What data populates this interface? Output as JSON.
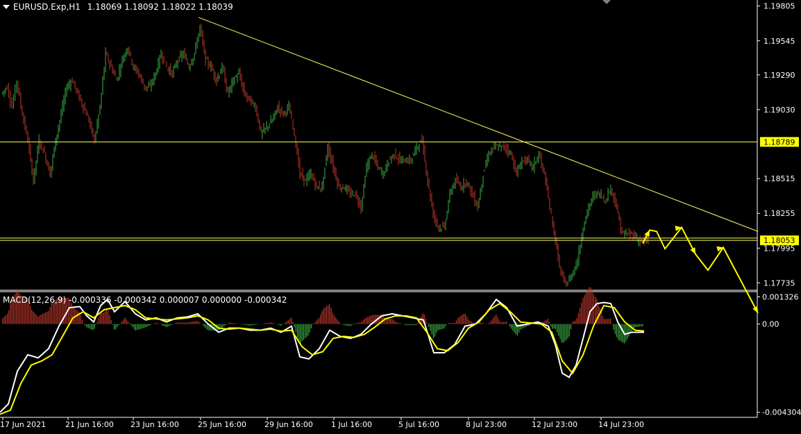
{
  "header": {
    "symbol": "EURUSD.Exp,H1",
    "ohlc": "1.18069 1.18092 1.18022 1.18039"
  },
  "indicator": {
    "label": "MACD(12,26,9) -0.000336 -0.000342 0.000007 0.000000 -0.000342"
  },
  "colors": {
    "background": "#000000",
    "bull": "#3cb043",
    "bear": "#c0392b",
    "level_line": "#ffff66",
    "level_tag": "#ffff00",
    "arrow": "#ffff00",
    "macd_main": "#ffffff",
    "macd_signal": "#ffff00",
    "grid": "#ffffff"
  },
  "chart_data": [
    {
      "type": "candlestick",
      "price_axis_ticks": [
        "1.19805",
        "1.19545",
        "1.19290",
        "1.19030",
        "1.18515",
        "1.18255",
        "1.17995",
        "1.17735"
      ],
      "ylim": [
        1.1768,
        1.1985
      ],
      "time_axis_ticks": [
        "17 Jun 2021",
        "21 Jun 16:00",
        "23 Jun 16:00",
        "25 Jun 16:00",
        "29 Jun 16:00",
        "1 Jul 16:00",
        "5 Jul 16:00",
        "8 Jul 23:00",
        "12 Jul 23:00",
        "14 Jul 23:00"
      ],
      "close_path": [
        [
          0,
          1.1915
        ],
        [
          8,
          1.192
        ],
        [
          15,
          1.1905
        ],
        [
          22,
          1.1925
        ],
        [
          30,
          1.19
        ],
        [
          38,
          1.188
        ],
        [
          46,
          1.185
        ],
        [
          54,
          1.188
        ],
        [
          62,
          1.187
        ],
        [
          70,
          1.1855
        ],
        [
          78,
          1.188
        ],
        [
          86,
          1.19
        ],
        [
          94,
          1.192
        ],
        [
          102,
          1.1925
        ],
        [
          110,
          1.1915
        ],
        [
          118,
          1.1905
        ],
        [
          126,
          1.1895
        ],
        [
          134,
          1.188
        ],
        [
          142,
          1.1905
        ],
        [
          150,
          1.1945
        ],
        [
          158,
          1.1935
        ],
        [
          166,
          1.1925
        ],
        [
          174,
          1.194
        ],
        [
          182,
          1.195
        ],
        [
          190,
          1.1935
        ],
        [
          198,
          1.193
        ],
        [
          206,
          1.192
        ],
        [
          214,
          1.192
        ],
        [
          222,
          1.193
        ],
        [
          230,
          1.1945
        ],
        [
          238,
          1.1935
        ],
        [
          246,
          1.193
        ],
        [
          254,
          1.194
        ],
        [
          262,
          1.1945
        ],
        [
          270,
          1.1935
        ],
        [
          278,
          1.1945
        ],
        [
          286,
          1.1965
        ],
        [
          294,
          1.194
        ],
        [
          302,
          1.1935
        ],
        [
          310,
          1.1925
        ],
        [
          318,
          1.1935
        ],
        [
          326,
          1.1915
        ],
        [
          334,
          1.1925
        ],
        [
          342,
          1.193
        ],
        [
          350,
          1.1915
        ],
        [
          358,
          1.191
        ],
        [
          366,
          1.1905
        ],
        [
          374,
          1.1885
        ],
        [
          382,
          1.189
        ],
        [
          390,
          1.1895
        ],
        [
          398,
          1.1905
        ],
        [
          406,
          1.19
        ],
        [
          414,
          1.1905
        ],
        [
          422,
          1.1885
        ],
        [
          430,
          1.1855
        ],
        [
          438,
          1.185
        ],
        [
          446,
          1.1855
        ],
        [
          454,
          1.1845
        ],
        [
          462,
          1.1845
        ],
        [
          470,
          1.1875
        ],
        [
          478,
          1.186
        ],
        [
          486,
          1.1845
        ],
        [
          494,
          1.1845
        ],
        [
          502,
          1.184
        ],
        [
          510,
          1.184
        ],
        [
          518,
          1.183
        ],
        [
          526,
          1.186
        ],
        [
          534,
          1.187
        ],
        [
          542,
          1.186
        ],
        [
          550,
          1.1855
        ],
        [
          558,
          1.1865
        ],
        [
          566,
          1.187
        ],
        [
          574,
          1.1865
        ],
        [
          582,
          1.1865
        ],
        [
          590,
          1.1865
        ],
        [
          598,
          1.1875
        ],
        [
          606,
          1.188
        ],
        [
          614,
          1.185
        ],
        [
          622,
          1.1825
        ],
        [
          630,
          1.1815
        ],
        [
          638,
          1.1815
        ],
        [
          646,
          1.184
        ],
        [
          654,
          1.185
        ],
        [
          662,
          1.1845
        ],
        [
          670,
          1.185
        ],
        [
          678,
          1.184
        ],
        [
          686,
          1.183
        ],
        [
          694,
          1.1855
        ],
        [
          702,
          1.187
        ],
        [
          710,
          1.1875
        ],
        [
          718,
          1.1875
        ],
        [
          726,
          1.1875
        ],
        [
          734,
          1.187
        ],
        [
          742,
          1.1855
        ],
        [
          750,
          1.1865
        ],
        [
          758,
          1.1865
        ],
        [
          766,
          1.186
        ],
        [
          774,
          1.187
        ],
        [
          782,
          1.1855
        ],
        [
          790,
          1.183
        ],
        [
          798,
          1.1805
        ],
        [
          806,
          1.178
        ],
        [
          814,
          1.1772
        ],
        [
          822,
          1.178
        ],
        [
          830,
          1.179
        ],
        [
          838,
          1.1815
        ],
        [
          846,
          1.183
        ],
        [
          854,
          1.184
        ],
        [
          862,
          1.184
        ],
        [
          870,
          1.1835
        ],
        [
          878,
          1.1845
        ],
        [
          886,
          1.183
        ],
        [
          894,
          1.181
        ],
        [
          902,
          1.181
        ],
        [
          910,
          1.181
        ],
        [
          918,
          1.1805
        ],
        [
          926,
          1.1805
        ],
        [
          932,
          1.1804
        ]
      ],
      "levels": [
        {
          "label": "1.18789",
          "value": 1.18789
        },
        {
          "label": "1.18053",
          "value": 1.18053
        }
      ],
      "second_level_value": 1.1807,
      "trendline": {
        "from": [
          286,
          1.1972
        ],
        "to": [
          1092,
          1.1812
        ]
      },
      "forecast_arrows": [
        [
          [
            926,
            1.1803
          ],
          [
            936,
            1.1813
          ],
          [
            946,
            1.1812
          ],
          [
            958,
            1.1799
          ],
          [
            982,
            1.1815
          ],
          [
            1002,
            1.1795
          ],
          [
            1020,
            1.1783
          ],
          [
            1042,
            1.18
          ],
          [
            1092,
            1.1751
          ]
        ]
      ]
    },
    {
      "type": "macd",
      "axis_ticks": [
        "0.001326",
        "0.00",
        "-0.004304"
      ],
      "ylim": [
        -0.00455,
        0.00158
      ],
      "zero": 0.0,
      "main_line": [
        [
          0,
          -0.0043
        ],
        [
          12,
          -0.0039
        ],
        [
          25,
          -0.0023
        ],
        [
          40,
          -0.0015
        ],
        [
          55,
          -0.00165
        ],
        [
          70,
          -0.0012
        ],
        [
          85,
          -0.0001
        ],
        [
          100,
          0.0008
        ],
        [
          115,
          0.00085
        ],
        [
          125,
          0.0004
        ],
        [
          135,
          0.0001
        ],
        [
          145,
          0.0009
        ],
        [
          155,
          0.0012
        ],
        [
          165,
          0.0006
        ],
        [
          180,
          0.0011
        ],
        [
          195,
          0.0005
        ],
        [
          210,
          0.0002
        ],
        [
          225,
          0.0003
        ],
        [
          240,
          0.0001
        ],
        [
          255,
          0.0003
        ],
        [
          270,
          0.00035
        ],
        [
          285,
          0.0005
        ],
        [
          300,
          0.0
        ],
        [
          315,
          -0.0004
        ],
        [
          330,
          -0.0002
        ],
        [
          345,
          -0.0002
        ],
        [
          360,
          -0.0003
        ],
        [
          375,
          -0.0003
        ],
        [
          390,
          -0.0002
        ],
        [
          405,
          -0.0004
        ],
        [
          420,
          -0.0001
        ],
        [
          432,
          -0.0016
        ],
        [
          445,
          -0.0017
        ],
        [
          460,
          -0.0012
        ],
        [
          475,
          -0.0003
        ],
        [
          490,
          -0.0006
        ],
        [
          505,
          -0.0007
        ],
        [
          520,
          -0.0005
        ],
        [
          535,
          0.0
        ],
        [
          550,
          0.0004
        ],
        [
          565,
          0.0005
        ],
        [
          580,
          0.0004
        ],
        [
          595,
          0.0003
        ],
        [
          610,
          0.0002
        ],
        [
          625,
          -0.0014
        ],
        [
          640,
          -0.0014
        ],
        [
          655,
          -0.001
        ],
        [
          670,
          -0.0001
        ],
        [
          685,
          0.0
        ],
        [
          700,
          0.0005
        ],
        [
          715,
          0.0012
        ],
        [
          730,
          0.0008
        ],
        [
          745,
          -0.0001
        ],
        [
          760,
          0.0
        ],
        [
          775,
          0.0001
        ],
        [
          790,
          -0.0001
        ],
        [
          800,
          -0.001
        ],
        [
          810,
          -0.0024
        ],
        [
          820,
          -0.0026
        ],
        [
          830,
          -0.002
        ],
        [
          840,
          -0.0007
        ],
        [
          850,
          0.0006
        ],
        [
          860,
          0.001
        ],
        [
          870,
          0.00105
        ],
        [
          880,
          0.001
        ],
        [
          890,
          0.0001
        ],
        [
          900,
          -0.0005
        ],
        [
          910,
          -0.0004
        ],
        [
          928,
          -0.0004
        ]
      ],
      "signal_line": [
        [
          0,
          -0.0044
        ],
        [
          15,
          -0.0042
        ],
        [
          30,
          -0.0029
        ],
        [
          45,
          -0.002
        ],
        [
          60,
          -0.0018
        ],
        [
          75,
          -0.0015
        ],
        [
          90,
          -0.0006
        ],
        [
          105,
          0.0003
        ],
        [
          120,
          0.0006
        ],
        [
          135,
          0.0003
        ],
        [
          150,
          0.0007
        ],
        [
          165,
          0.0008
        ],
        [
          180,
          0.0009
        ],
        [
          195,
          0.0007
        ],
        [
          210,
          0.0003
        ],
        [
          225,
          0.00025
        ],
        [
          240,
          0.0002
        ],
        [
          255,
          0.00025
        ],
        [
          270,
          0.0003
        ],
        [
          285,
          0.0004
        ],
        [
          300,
          0.0002
        ],
        [
          315,
          -0.0002
        ],
        [
          330,
          -0.00025
        ],
        [
          345,
          -0.0002
        ],
        [
          360,
          -0.00025
        ],
        [
          375,
          -0.0003
        ],
        [
          390,
          -0.00025
        ],
        [
          405,
          -0.00035
        ],
        [
          420,
          -0.0003
        ],
        [
          435,
          -0.0011
        ],
        [
          450,
          -0.0015
        ],
        [
          465,
          -0.00135
        ],
        [
          480,
          -0.0007
        ],
        [
          495,
          -0.0006
        ],
        [
          510,
          -0.00065
        ],
        [
          525,
          -0.0005
        ],
        [
          540,
          -0.00015
        ],
        [
          555,
          0.00025
        ],
        [
          570,
          0.0004
        ],
        [
          585,
          0.0004
        ],
        [
          600,
          0.0003
        ],
        [
          615,
          -0.0004
        ],
        [
          630,
          -0.0012
        ],
        [
          645,
          -0.0013
        ],
        [
          660,
          -0.0009
        ],
        [
          675,
          -0.0002
        ],
        [
          690,
          0.0001
        ],
        [
          705,
          0.0007
        ],
        [
          720,
          0.001
        ],
        [
          735,
          0.0006
        ],
        [
          750,
          0.0001
        ],
        [
          765,
          5e-05
        ],
        [
          780,
          0.0
        ],
        [
          795,
          -0.0004
        ],
        [
          810,
          -0.0018
        ],
        [
          825,
          -0.0024
        ],
        [
          840,
          -0.0015
        ],
        [
          855,
          -0.0001
        ],
        [
          870,
          0.0009
        ],
        [
          885,
          0.0008
        ],
        [
          900,
          0.0001
        ],
        [
          915,
          -0.0003
        ],
        [
          928,
          -0.00034
        ]
      ]
    }
  ]
}
